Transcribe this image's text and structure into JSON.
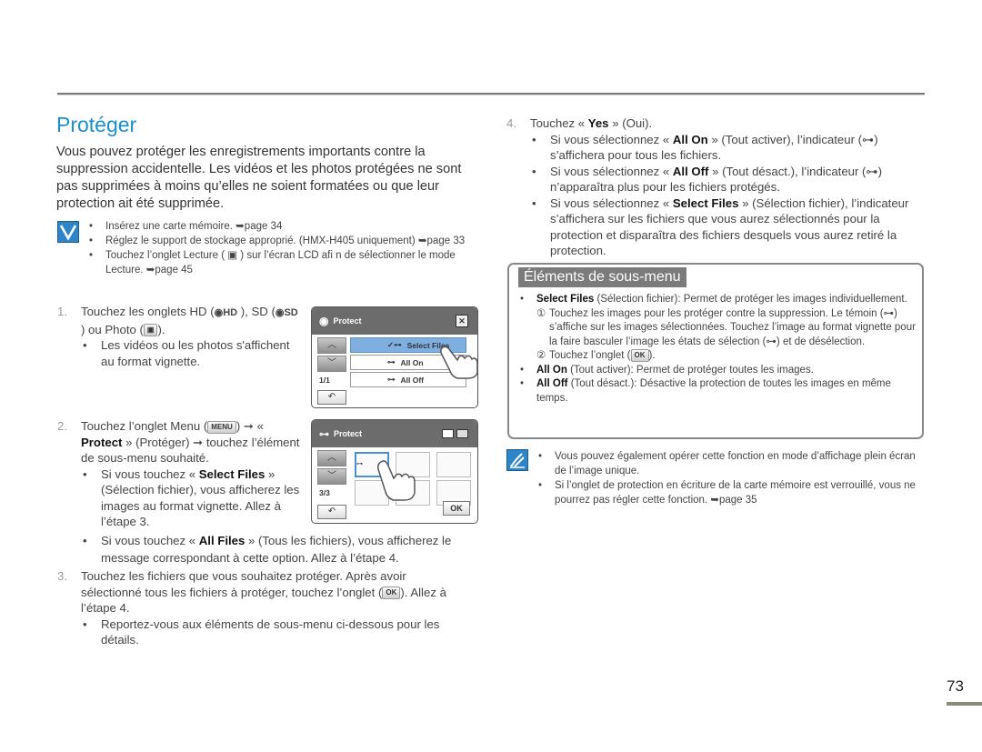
{
  "page": {
    "title": "Protéger",
    "intro": "Vous pouvez protéger les enregistrements importants contre la suppression accidentelle. Les vidéos et les photos protégées ne sont pas supprimées à moins qu’elles ne soient formatées ou que leur protection ait été supprimée.",
    "page_number": "73"
  },
  "precheck": {
    "icon": "checkbox-icon",
    "items": [
      "Insérez une carte mémoire. ➥page 34",
      "Réglez le support de stockage approprié. (HMX-H405 uniquement) ➥page 33",
      "Touchez l’onglet Lecture ( ▣ ) sur l’écran LCD afi n de sélectionner le mode Lecture. ➥page 45"
    ]
  },
  "steps": [
    {
      "num": "1.",
      "text_a": "Touchez les onglets HD (",
      "hd": "HD",
      "text_b": " ), SD (",
      "sd": "SD",
      "text_c": " ) ou Photo (",
      "text_d": ").",
      "subs": [
        "Les vidéos ou les photos s'affichent au format vignette."
      ]
    },
    {
      "num": "2.",
      "text_a": "Touchez l’onglet Menu (",
      "menu": "MENU",
      "text_b": ") ➞ « ",
      "bold": "Protect",
      "text_c": " » (Protéger) ➞ touchez l’élément de sous-menu souhaité.",
      "subs": [
        {
          "pre": "Si vous touchez « ",
          "bold": "Select Files",
          "post": " » (Sélection fichier), vous afficherez les images au format vignette. Allez à l’étape 3."
        },
        {
          "pre": "Si vous touchez « ",
          "bold": "All Files",
          "post": " » (Tous les fichiers), vous afficherez le message correspondant à cette option. Allez à l’étape 4."
        }
      ]
    },
    {
      "num": "3.",
      "text_a": "Touchez les fichiers que vous souhaitez protéger. Après avoir sélectionné tous les fichiers à protéger, touchez l’onglet (",
      "ok": "OK",
      "text_b": "). Allez à l’étape 4.",
      "subs": [
        "Reportez-vous aux éléments de sous-menu ci-dessous pour les détails."
      ]
    },
    {
      "num": "4.",
      "text_a": "Touchez « ",
      "bold": "Yes",
      "text_b": " » (Oui).",
      "subs": [
        {
          "pre": "Si vous sélectionnez « ",
          "bold": "All On",
          "post": " » (Tout activer), l’indicateur (⊶) s’affichera pour tous les fichiers."
        },
        {
          "pre": "Si vous sélectionnez « ",
          "bold": "All Off",
          "post": " » (Tout désact.), l’indicateur (⊶) n’apparaîtra plus pour les fichiers protégés."
        },
        {
          "pre": "Si vous sélectionnez « ",
          "bold": "Select Files",
          "post": " » (Sélection fichier), l’indicateur s’affichera sur les fichiers que vous aurez sélectionnés pour la protection et disparaîtra des fichiers desquels vous aurez retiré la protection."
        }
      ]
    }
  ],
  "screen1": {
    "title": "Protect",
    "counter": "1/1",
    "options": [
      "Select Files",
      "All On",
      "All Off"
    ],
    "selected": "Select Files",
    "close": "✕",
    "up": "︿",
    "down": "﹀",
    "back": "↶"
  },
  "screen2": {
    "title": "Protect",
    "counter": "3/3",
    "ok": "OK",
    "up": "︿",
    "down": "﹀",
    "back": "↶"
  },
  "submenu": {
    "title": "Éléments de sous-menu",
    "items": [
      {
        "bold": "Select Files",
        "text": " (Sélection fichier): Permet de protéger les images individuellement."
      },
      {
        "bold": "All On",
        "text": " (Tout activer): Permet de protéger toutes les images."
      },
      {
        "bold": "All Off",
        "text": " (Tout désact.): Désactive la protection de toutes les images en même temps."
      }
    ],
    "circ1_num": "①",
    "circ1": "Touchez les images pour les protéger contre la suppression. Le témoin (⊶) s’affiche sur les images sélectionnées. Touchez l’image au format vignette pour la faire basculer l’image les états de sélection (⊶) et de désélection.",
    "circ2_num": "②",
    "circ2_a": "Touchez l’onglet (",
    "circ2_ok": "OK",
    "circ2_b": ")."
  },
  "tips": {
    "icon": "pencil-note-icon",
    "items": [
      "Vous pouvez également opérer cette fonction en mode d’affichage plein écran de l’image unique.",
      "Si l’onglet de protection en écriture de la carte mémoire est verrouillé, vous ne pourrez pas régler cette fonction. ➥page 35"
    ]
  }
}
